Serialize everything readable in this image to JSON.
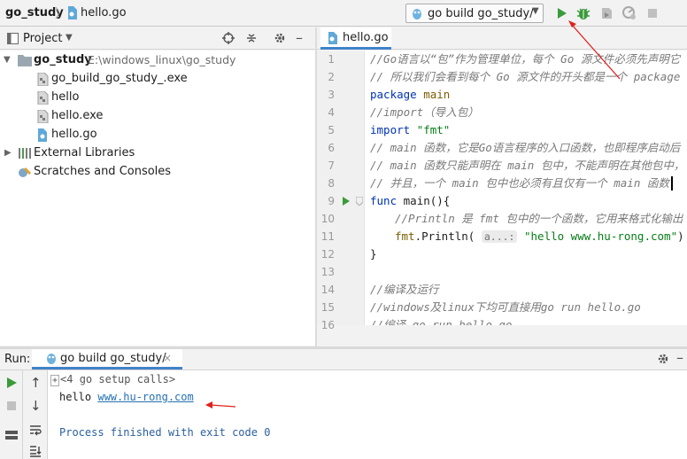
{
  "navbar": {
    "project": "go_study",
    "separator": "〉",
    "file": "hello.go",
    "run_config": "go build go_study/"
  },
  "project_panel": {
    "title": "Project",
    "tree": [
      {
        "label": "go_study",
        "path": "E:\\windows_linux\\go_study"
      },
      {
        "label": "go_build_go_study_.exe"
      },
      {
        "label": "hello"
      },
      {
        "label": "hello.exe"
      },
      {
        "label": "hello.go"
      },
      {
        "label": "External Libraries"
      },
      {
        "label": "Scratches and Consoles"
      }
    ]
  },
  "editor": {
    "tab": "hello.go",
    "line_numbers": [
      "1",
      "2",
      "3",
      "4",
      "5",
      "6",
      "7",
      "8",
      "9",
      "10",
      "11",
      "12",
      "13",
      "14",
      "15",
      "16"
    ],
    "lines": {
      "l1": "//Go语言以“包”作为管理单位，每个 Go 源文件必须先声明它",
      "l2": "// 所以我们会看到每个 Go 源文件的开头都是一个 package",
      "l3_kw": "package",
      "l3_name": "main",
      "l4": "//import（导入包）",
      "l5_kw": "import",
      "l5_str": "\"fmt\"",
      "l6": "// main 函数，它是Go语言程序的入口函数，也即程序启动后",
      "l7": "// main 函数只能声明在 main 包中，不能声明在其他包中，",
      "l8": "// 并且，一个 main 包中也必须有且仅有一个 main 函数",
      "l9_kw": "func",
      "l9_rest": "main(){",
      "l10": "//Println 是 fmt 包中的一个函数，它用来格式化输出",
      "l11_pkg": "fmt",
      "l11_call": ".Println(",
      "l11_hint": "a...:",
      "l11_str": "\"hello www.hu-rong.com\"",
      "l11_end": ")",
      "l12": "}",
      "l13": "",
      "l14": "//编译及运行",
      "l15": "//windows及linux下均可直接用go run hello.go",
      "l16": "//编译 go run hello.go"
    }
  },
  "run_panel": {
    "label": "Run:",
    "tab": "go build go_study/",
    "console": {
      "setup": "<4 go setup calls>",
      "out_prefix": "hello ",
      "out_link": "www.hu-rong.com",
      "finished": "Process finished with exit code 0"
    }
  },
  "colors": {
    "annotation_arrow": "#e0201b",
    "run_green": "#3a9b3a",
    "link_blue": "#2470b3"
  }
}
